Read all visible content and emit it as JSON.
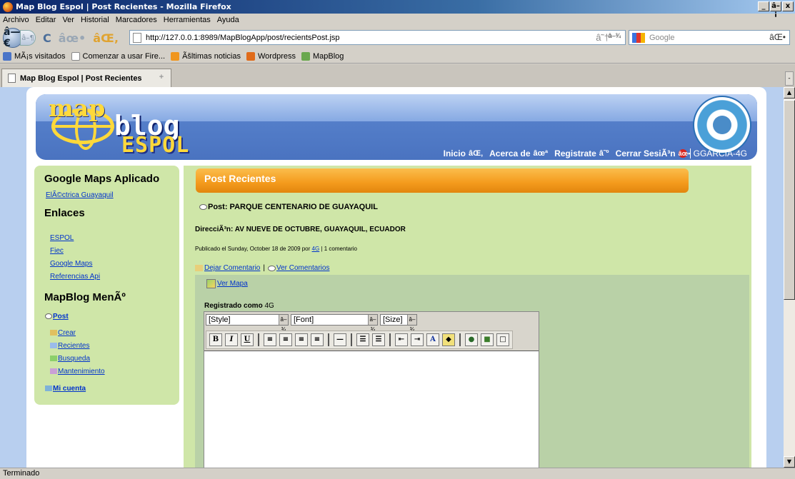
{
  "window": {
    "title": "Map Blog Espol | Post Recientes - Mozilla Firefox",
    "min_label": "_",
    "max_label": "â–¡",
    "close_label": "x"
  },
  "menu": [
    "Archivo",
    "Editar",
    "Ver",
    "Historial",
    "Marcadores",
    "Herramientas",
    "Ayuda"
  ],
  "nav": {
    "url": "http://127.0.0.1:8989/MapBlogApp/post/recientsPost.jsp",
    "search_placeholder": "Google",
    "back_glyph": "â—€",
    "forward_glyph": "â–¶",
    "reload_glyph": "C",
    "stop_glyph": "âœ•",
    "home_glyph": "âŒ‚",
    "star_glyph": "â˜†",
    "drop_glyph": "â–¾",
    "search_glyph": "âŒ•"
  },
  "bookmarks": [
    {
      "label": "MÃ¡s visitados",
      "color": "#4a74c8"
    },
    {
      "label": "Comenzar a usar Fire...",
      "color": "#d7d7d7"
    },
    {
      "label": "Ãšltimas noticias",
      "color": "#f0961e"
    },
    {
      "label": "Wordpress",
      "color": "#e06b1a"
    },
    {
      "label": "MapBlog",
      "color": "#6aa84f"
    }
  ],
  "tab": {
    "label": "Map Blog Espol | Post Recientes",
    "close_glyph": "+",
    "scroll_glyph": "-"
  },
  "status": "Terminado",
  "site": {
    "logo_map": "map",
    "logo_blog": "blog",
    "logo_espol": "ESPOL",
    "nav": [
      {
        "label": "Inicio",
        "icon": "âŒ‚"
      },
      {
        "label": "Acerca de",
        "icon": "âœª"
      },
      {
        "label": "Registrate",
        "icon": "â˜º"
      },
      {
        "label": "Cerrar SesiÃ³n",
        "icon": "âœ•"
      }
    ],
    "user": "GGARCIA-4G"
  },
  "sidebar": {
    "gm_title": "Google Maps Aplicado",
    "gm_link": "ElÃ©ctrica Guayaquil",
    "enlaces_title": "Enlaces",
    "enlaces": [
      "ESPOL",
      "Fiec",
      "Google Maps",
      "Referencias Api"
    ],
    "menu_title": "MapBlog MenÃº",
    "post_label": "Post",
    "post_items": [
      "Crear",
      "Recientes",
      "Busqueda",
      "Mantenimiento"
    ],
    "mi_cuenta": "Mi cuenta"
  },
  "main": {
    "header": "Post Recientes",
    "post_title": "Post: PARQUE CENTENARIO DE GUAYAQUIL",
    "address": "DirecciÃ³n: AV NUEVE DE OCTUBRE, GUAYAQUIL, ECUADOR",
    "published_prefix": "Publicado el Sunday, October 18 de 2009 por",
    "author": "4G",
    "comments_suffix": "| 1 comentario",
    "dejar": "Dejar Comentario",
    "separator": "|",
    "ver_comentarios": "Ver Comentarios",
    "ver_mapa": "Ver Mapa",
    "registrado_prefix": "Registrado como",
    "registrado_user": "4G",
    "editor_selects": [
      "[Style]",
      "[Font]",
      "[Size]"
    ],
    "dd_glyph": "â–¾"
  }
}
